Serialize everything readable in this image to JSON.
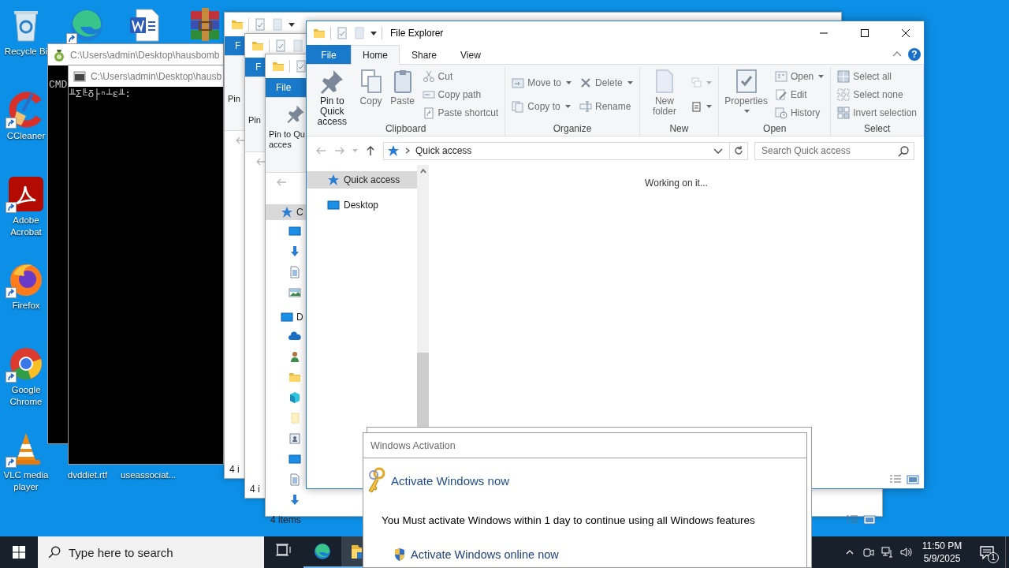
{
  "desktop_icons": [
    {
      "kind": "recycle-bin",
      "label": "Recycle Bi",
      "shortcut": false
    },
    {
      "kind": "wave-browser",
      "shortcut": true
    },
    {
      "kind": "word-document",
      "shortcut": false
    },
    {
      "kind": "archive",
      "shortcut": false
    },
    {
      "kind": "cleaner",
      "label": "CCleaner",
      "shortcut": true
    },
    {
      "kind": "pdf",
      "label": "Adobe Acrobat",
      "shortcut": true
    },
    {
      "kind": "fox-browser",
      "label": "Firefox",
      "shortcut": true
    },
    {
      "kind": "round-browser",
      "label": "Google Chrome",
      "shortcut": true
    },
    {
      "kind": "cone",
      "label": "VLC media player",
      "shortcut": true
    },
    {
      "label": "dvddiet.rtf",
      "shortcut": false
    },
    {
      "label": "useassociat...",
      "shortcut": false
    }
  ],
  "cmd_windows": [
    {
      "title": "C:\\Users\\admin\\Desktop\\hausbomb",
      "output": "CMD"
    },
    {
      "title": "C:\\Users\\admin\\Desktop\\hausb",
      "output": "╨Σ╚δ├ⁿ┴ε╨:"
    }
  ],
  "background_explorers": [
    {
      "file_tab": "F",
      "pin_lines": [
        "Pin"
      ],
      "status": "4 i"
    },
    {
      "file_tab": "F",
      "pin_lines": [
        "Pin"
      ],
      "status": "4 i"
    },
    {
      "file_tab": "File",
      "pin_lines": [
        "Pin to Qu",
        "acces"
      ],
      "status": "4 items",
      "nav": [
        {
          "kind": "star",
          "label": "C",
          "selected": true,
          "children": [
            {
              "kind": "desktop",
              "selected": false
            },
            {
              "kind": "download",
              "selected": false
            },
            {
              "kind": "document",
              "selected": false
            },
            {
              "kind": "picture",
              "selected": false
            }
          ]
        },
        {
          "kind": "desktop",
          "label": "D",
          "selected": false,
          "children": [
            {
              "kind": "cloud",
              "selected": false
            },
            {
              "kind": "person",
              "selected": false
            },
            {
              "kind": "folder",
              "selected": false
            },
            {
              "kind": "cube",
              "selected": false
            },
            {
              "kind": "pale-folder",
              "selected": false
            },
            {
              "kind": "contact",
              "selected": false
            },
            {
              "kind": "desktop",
              "selected": false
            },
            {
              "kind": "document",
              "selected": false
            },
            {
              "kind": "download",
              "selected": false
            }
          ]
        }
      ]
    }
  ],
  "explorer": {
    "title": "File Explorer",
    "help": "?",
    "tabs": [
      {
        "label": "File",
        "kind": "file",
        "selected": false
      },
      {
        "label": "Home",
        "kind": "tab",
        "selected": true
      },
      {
        "label": "Share",
        "kind": "tab",
        "selected": false
      },
      {
        "label": "View",
        "kind": "tab",
        "selected": false
      }
    ],
    "groups": [
      {
        "name": "Clipboard",
        "columns": [
          [
            {
              "label": "Pin to Quick access",
              "kind": "large",
              "disabled": false,
              "menu": false
            }
          ],
          [
            {
              "label": "Copy",
              "kind": "large",
              "disabled": true,
              "menu": false
            }
          ],
          [
            {
              "label": "Paste",
              "kind": "large",
              "disabled": true,
              "menu": false
            }
          ],
          [
            {
              "label": "Cut",
              "kind": "small",
              "disabled": true,
              "menu": false
            },
            {
              "label": "Copy path",
              "kind": "small",
              "disabled": true,
              "menu": false
            },
            {
              "label": "Paste shortcut",
              "kind": "small",
              "disabled": true,
              "menu": false
            }
          ]
        ]
      },
      {
        "name": "Organize",
        "columns": [
          [
            {
              "label": "Move to",
              "kind": "small",
              "disabled": true,
              "menu": true
            },
            {
              "label": "Copy to",
              "kind": "small",
              "disabled": true,
              "menu": true
            }
          ],
          [
            {
              "label": "Delete",
              "kind": "small",
              "disabled": true,
              "menu": true
            },
            {
              "label": "Rename",
              "kind": "small",
              "disabled": true,
              "menu": false
            }
          ]
        ]
      },
      {
        "name": "New",
        "columns": [
          [
            {
              "label": "New folder",
              "kind": "large",
              "disabled": true,
              "menu": false
            }
          ],
          [
            {
              "kind": "icon",
              "disabled": true,
              "menu": true
            },
            {
              "kind": "icon",
              "disabled": false,
              "menu": true
            }
          ]
        ]
      },
      {
        "name": "Open",
        "columns": [
          [
            {
              "label": "Properties",
              "kind": "large",
              "disabled": true,
              "menu": true
            }
          ],
          [
            {
              "label": "Open",
              "kind": "small",
              "disabled": true,
              "menu": true
            },
            {
              "label": "Edit",
              "kind": "small",
              "disabled": true,
              "menu": false
            },
            {
              "label": "History",
              "kind": "small",
              "disabled": true,
              "menu": false
            }
          ]
        ]
      },
      {
        "name": "Select",
        "columns": [
          [
            {
              "label": "Select all",
              "kind": "small",
              "disabled": true,
              "menu": false
            },
            {
              "label": "Select none",
              "kind": "small",
              "disabled": true,
              "menu": false
            },
            {
              "label": "Invert selection",
              "kind": "small",
              "disabled": true,
              "menu": false
            }
          ]
        ]
      }
    ],
    "address": {
      "path": "Quick access"
    },
    "search": {
      "placeholder": "Search Quick access"
    },
    "nav": [
      {
        "kind": "star",
        "label": "Quick access",
        "selected": true
      },
      {
        "kind": "desktop",
        "label": "Desktop",
        "selected": false
      }
    ],
    "content": "Working on it..."
  },
  "taskbar": {
    "search": {
      "placeholder": "Type here to search"
    },
    "apps": [
      {
        "kind": "task-view",
        "running": false,
        "selected": false
      },
      {
        "kind": "wave-browser",
        "running": true,
        "selected": false
      },
      {
        "kind": "folder",
        "running": true,
        "selected": true
      }
    ],
    "time": "11:50 PM",
    "date": "5/9/2025",
    "notifications": "1"
  },
  "activation": {
    "window_title": "Windows Activation",
    "heading": "Activate Windows now",
    "message": "You Must activate Windows within 1 day to continue using all Windows features",
    "action": "Activate Windows online now"
  }
}
